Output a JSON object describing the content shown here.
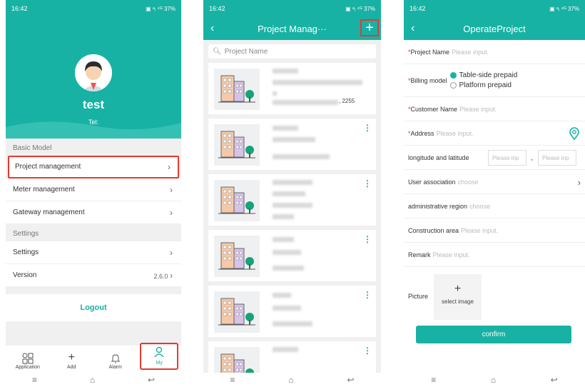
{
  "status": {
    "time": "16:42",
    "right": "▣ ᵃᵢ ⁴ᴳ 37%"
  },
  "colors": {
    "accent": "#17b2a4",
    "highlight": "#e23b2e"
  },
  "profile": {
    "name": "test",
    "tel": "Tel:"
  },
  "menu": {
    "section_basic": "Basic Model",
    "project": "Project management",
    "meter": "Meter management",
    "gateway": "Gateway management",
    "section_settings": "Settings",
    "settings": "Settings",
    "version_label": "Version",
    "version_value": "2.6.0",
    "logout": "Logout"
  },
  "tabs": [
    {
      "label": "Application",
      "icon": "grid-icon"
    },
    {
      "label": "Add",
      "icon": "plus-icon"
    },
    {
      "label": "Alarm",
      "icon": "bell-icon"
    },
    {
      "label": "My",
      "icon": "user-icon"
    }
  ],
  "list": {
    "title": "Project Manag···",
    "search_placeholder": "Project Name",
    "card_fragment": ", 2255"
  },
  "form": {
    "title": "OperateProject",
    "project_name": "Project Name",
    "placeholder": "Please input.",
    "billing": "Billing model",
    "billing_opt1": "Table-side prepaid",
    "billing_opt2": "Platform prepaid",
    "customer": "Customer Name",
    "address": "Address",
    "lonlat": "longitude and latitude",
    "lonlat_ph": "Please inp",
    "comma": ",",
    "user_assoc": "User association",
    "choose": "choose",
    "admin_region": "administrative region",
    "construction": "Construction area",
    "remark": "Remark",
    "picture": "Picture",
    "select_image": "select image",
    "confirm": "confirm"
  }
}
